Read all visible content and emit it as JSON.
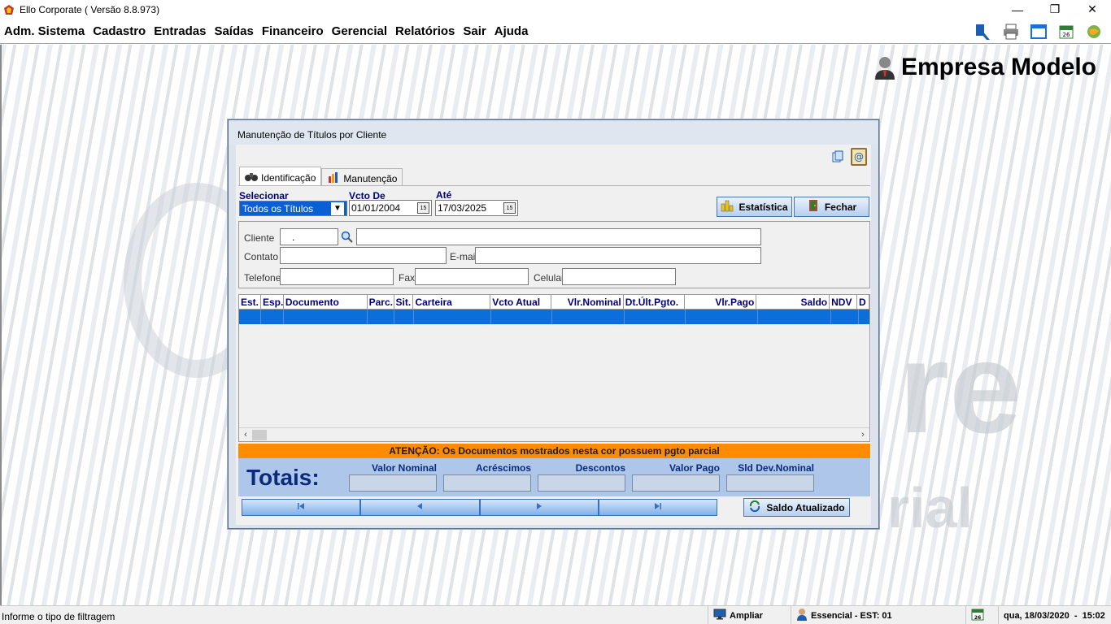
{
  "window": {
    "title": "Ello Corporate ( Versão 8.8.973)",
    "controls": {
      "minimize": "—",
      "restore": "❐",
      "close": "✕"
    }
  },
  "menu": {
    "items": [
      "Adm. Sistema",
      "Cadastro",
      "Entradas",
      "Saídas",
      "Financeiro",
      "Gerencial",
      "Relatórios",
      "Sair",
      "Ajuda"
    ],
    "toolbar_badge": "26"
  },
  "company": {
    "name": "Empresa Modelo"
  },
  "dialog": {
    "title": "Manutenção de Títulos por Cliente",
    "tabs": [
      "Identificação",
      "Manutenção"
    ],
    "filters": {
      "selecionar_label": "Selecionar",
      "selecionar_value": "Todos os Títulos",
      "vcto_de_label": "Vcto De",
      "vcto_de_value": "01/01/2004",
      "ate_label": "Até",
      "ate_value": "17/03/2025",
      "cal_glyph": "15"
    },
    "buttons": {
      "estatistica": "Estatística",
      "fechar": "Fechar",
      "saldo_atualizado": "Saldo Atualizado"
    },
    "client": {
      "cliente_label": "Cliente",
      "cliente_code": ".",
      "contato_label": "Contato",
      "email_label": "E-mail",
      "telefone_label": "Telefone",
      "fax_label": "Fax",
      "celular_label": "Celular"
    },
    "grid": {
      "columns": [
        "Est.",
        "Esp.",
        "Documento",
        "Parc.",
        "Sit.",
        "Carteira",
        "Vcto Atual",
        "Vlr.Nominal",
        "Dt.Últ.Pgto.",
        "Vlr.Pago",
        "Saldo",
        "NDV",
        "D"
      ]
    },
    "attention": "ATENÇÃO: Os Documentos mostrados nesta cor possuem pgto parcial",
    "totals": {
      "title": "Totais:",
      "labels": [
        "Valor Nominal",
        "Acréscimos",
        "Descontos",
        "Valor Pago",
        "Sld Dev.Nominal"
      ]
    }
  },
  "statusbar": {
    "hint": "Informe o tipo de filtragem",
    "ampliar": "Ampliar",
    "user": "Essencial - EST: 01",
    "badge": "26",
    "datetime": "qua, 18/03/2020  -  15:02"
  },
  "colors": {
    "selection": "#0a6fd8",
    "attention_bg": "#ff8c00",
    "totals_bg": "#aec6ea",
    "label_blue": "#00007a"
  }
}
